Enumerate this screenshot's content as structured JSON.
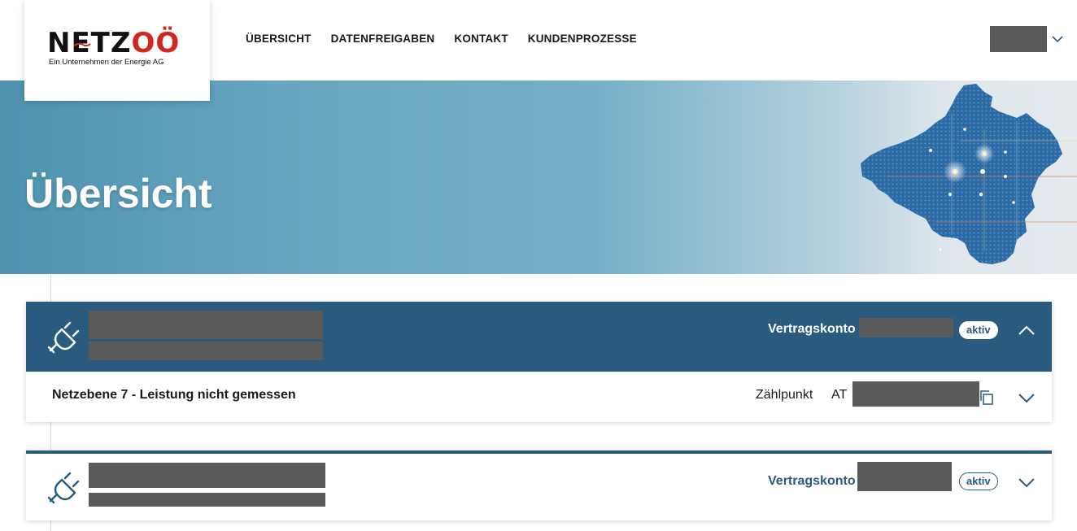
{
  "logo": {
    "brand_primary": "NETZ",
    "brand_accent": "OÖ",
    "tagline": "Ein Unternehmen der Energie AG",
    "primary_color": "#111111",
    "accent_color": "#d3261d"
  },
  "nav": {
    "items": [
      {
        "label": "ÜBERSICHT"
      },
      {
        "label": "DATENFREIGABEN"
      },
      {
        "label": "KONTAKT"
      },
      {
        "label": "KUNDENPROZESSE"
      }
    ]
  },
  "user_menu": {
    "name": "",
    "icon": "chevron-down-icon"
  },
  "hero": {
    "title": "Übersicht"
  },
  "colors": {
    "brand_blue": "#2a5a7e",
    "redaction": "#5a5a5a"
  },
  "contracts": [
    {
      "expanded": true,
      "vertragskonto_label": "Vertragskonto",
      "vertragskonto_value": "",
      "status": "aktiv",
      "icon": "plug-icon",
      "netzebene": "Netzebene 7 - Leistung nicht gemessen",
      "zaehlpunkt_label": "Zählpunkt",
      "zaehlpunkt_prefix": "AT",
      "zaehlpunkt_value": ""
    },
    {
      "expanded": false,
      "vertragskonto_label": "Vertragskonto",
      "vertragskonto_value": "",
      "status": "aktiv",
      "icon": "plug-icon"
    }
  ]
}
